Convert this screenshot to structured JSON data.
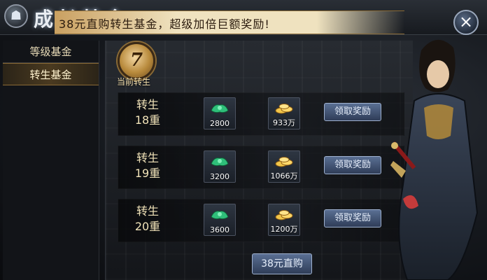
{
  "window": {
    "title": "成长基金",
    "close_symbol": "×"
  },
  "sidebar": {
    "items": [
      {
        "label": "等级基金",
        "active": false
      },
      {
        "label": "转生基金",
        "active": true
      }
    ]
  },
  "header": {
    "text": "38元直购转生基金，超级加倍巨额奖励!"
  },
  "current_level": {
    "value": "7",
    "label": "当前转生"
  },
  "rewards": [
    {
      "line1": "转生",
      "line2": "18重",
      "jade": "2800",
      "gold": "933万",
      "button": "领取奖励"
    },
    {
      "line1": "转生",
      "line2": "19重",
      "jade": "3200",
      "gold": "1066万",
      "button": "领取奖励"
    },
    {
      "line1": "转生",
      "line2": "20重",
      "jade": "3600",
      "gold": "1200万",
      "button": "领取奖励"
    }
  ],
  "buy_button": {
    "label": "38元直购"
  },
  "icons": {
    "jade": "jade-ingot-icon",
    "gold": "gold-coins-icon",
    "emblem": "bag-emblem-icon",
    "close": "close-icon"
  },
  "colors": {
    "accent_gold": "#c9a061",
    "button_blue": "#3e4f6f",
    "text_light": "#f0e2b8"
  }
}
